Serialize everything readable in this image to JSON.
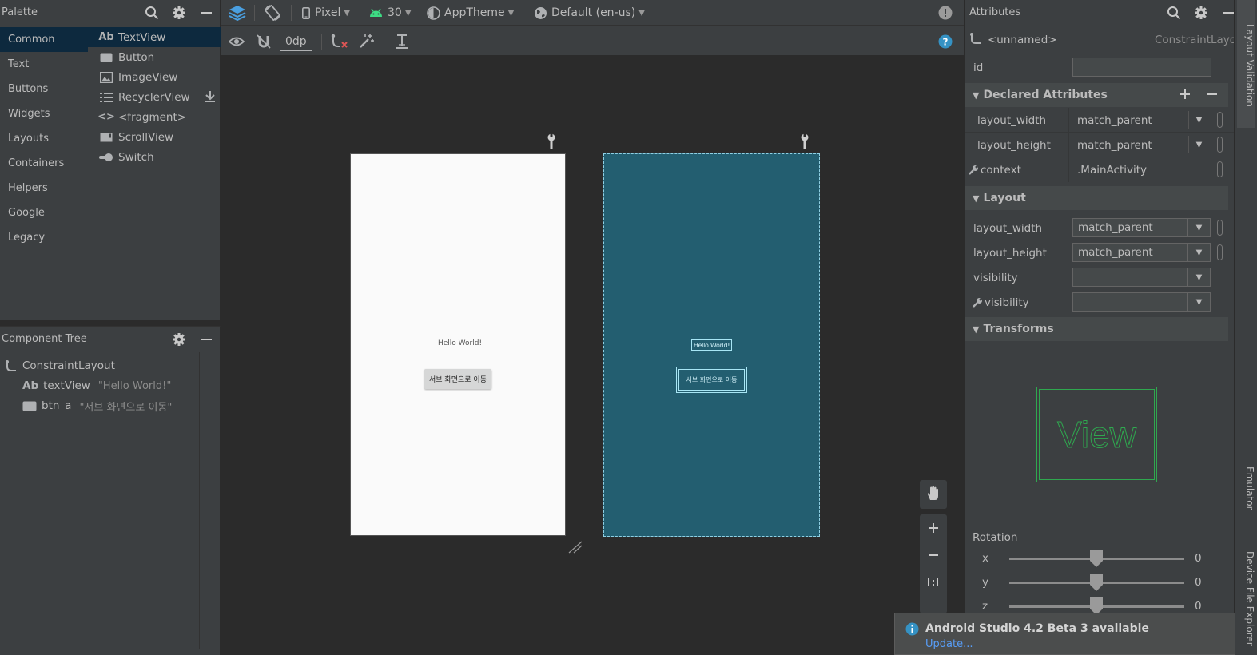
{
  "palette": {
    "title": "Palette",
    "categories": [
      "Common",
      "Text",
      "Buttons",
      "Widgets",
      "Layouts",
      "Containers",
      "Helpers",
      "Google",
      "Legacy"
    ],
    "widgets": [
      {
        "icon_text": "Ab",
        "label": "TextView"
      },
      {
        "label": "Button"
      },
      {
        "label": "ImageView"
      },
      {
        "label": "RecyclerView"
      },
      {
        "icon_text": "<>",
        "label": "<fragment>"
      },
      {
        "label": "ScrollView"
      },
      {
        "label": "Switch"
      }
    ]
  },
  "component_tree": {
    "title": "Component Tree",
    "root": "ConstraintLayout",
    "children": [
      {
        "icon_text": "Ab",
        "name": "textView",
        "text": "\"Hello World!\""
      },
      {
        "name": "btn_a",
        "text": "\"서브 화면으로 이동\""
      }
    ]
  },
  "toolbar": {
    "device": "Pixel",
    "api": "30",
    "theme": "AppTheme",
    "locale": "Default (en-us)",
    "margin": "0dp"
  },
  "canvas": {
    "hello_text": "Hello World!",
    "button_text": "서브 화면으로 이동"
  },
  "attributes": {
    "title": "Attributes",
    "component_name": "<unnamed>",
    "component_type": "ConstraintLayout",
    "id_label": "id",
    "declared": {
      "title": "Declared Attributes",
      "rows": [
        {
          "label": "layout_width",
          "value": "match_parent"
        },
        {
          "label": "layout_height",
          "value": "match_parent"
        },
        {
          "label": "context",
          "value": ".MainActivity"
        }
      ]
    },
    "layout": {
      "title": "Layout",
      "rows": [
        {
          "label": "layout_width",
          "value": "match_parent"
        },
        {
          "label": "layout_height",
          "value": "match_parent"
        },
        {
          "label": "visibility",
          "value": ""
        },
        {
          "label": "visibility",
          "value": ""
        }
      ]
    },
    "transforms": {
      "title": "Transforms",
      "preview_text": "View",
      "rotation_label": "Rotation",
      "axes": [
        {
          "axis": "x",
          "value": "0"
        },
        {
          "axis": "y",
          "value": "0"
        },
        {
          "axis": "z",
          "value": "0"
        }
      ]
    }
  },
  "right_strip": {
    "tabs": [
      "Layout Validation",
      "Emulator",
      "Device File Explorer"
    ]
  },
  "notification": {
    "title": "Android Studio 4.2 Beta 3 available",
    "link": "Update..."
  },
  "colors": {
    "panel": "#3c3f41",
    "canvas": "#2b2b2b",
    "selection": "#0d293e",
    "blueprint": "#235e70",
    "accent_green": "#3ddc84",
    "link": "#589df6"
  }
}
